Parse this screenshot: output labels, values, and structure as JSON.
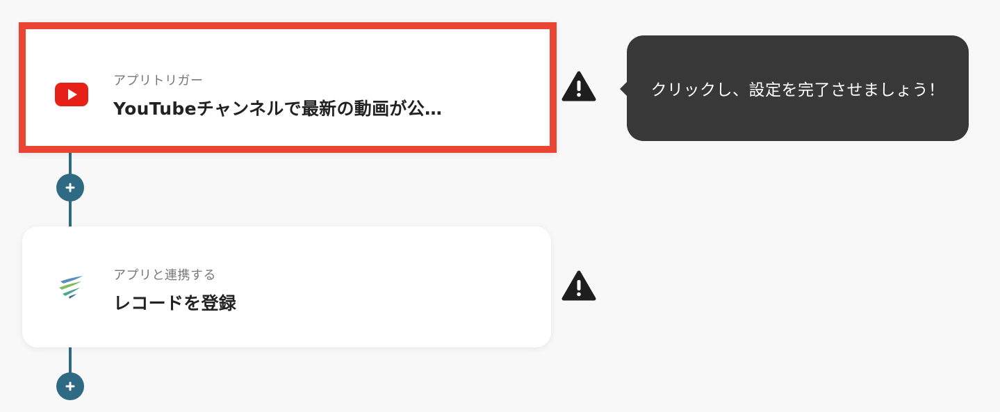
{
  "flow": {
    "steps": [
      {
        "type_label": "アプリトリガー",
        "title": "YouTubeチャンネルで最新の動画が公…",
        "app_icon": "youtube-logo-icon",
        "status_icon": "warning-icon",
        "highlighted": true
      },
      {
        "type_label": "アプリと連携する",
        "title": "レコードを登録",
        "app_icon": "service-logo-icon",
        "status_icon": "warning-icon",
        "highlighted": false
      }
    ],
    "add_step_icon": "plus-icon"
  },
  "tooltip": {
    "text": "クリックし、設定を完了させましょう！"
  },
  "colors": {
    "highlight_border": "#ea4432",
    "connector": "#2e6a84",
    "tooltip_bg": "#383838",
    "youtube_red": "#e62117",
    "warning": "#1e1e1e"
  }
}
